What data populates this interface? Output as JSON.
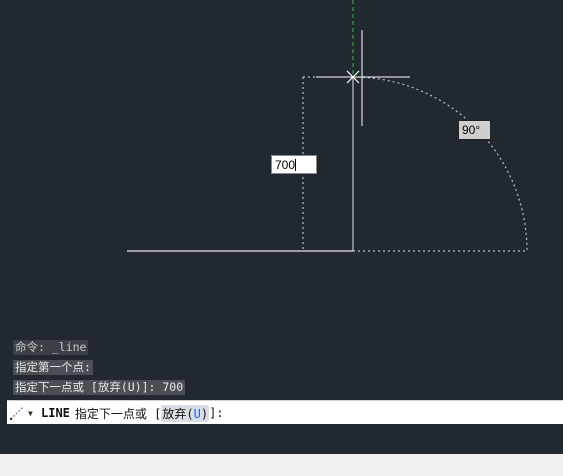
{
  "drawing": {
    "dynamic_input_value": "700",
    "angle_tooltip": "90°"
  },
  "command_history": [
    "命令: _line",
    "指定第一个点:",
    "指定下一点或 [放弃(U)]: 700"
  ],
  "command_line": {
    "command_name": "LINE",
    "prompt": "指定下一点或 [",
    "option_label": "放弃(",
    "option_key": "U",
    "option_close": ")",
    "suffix": "]:"
  }
}
